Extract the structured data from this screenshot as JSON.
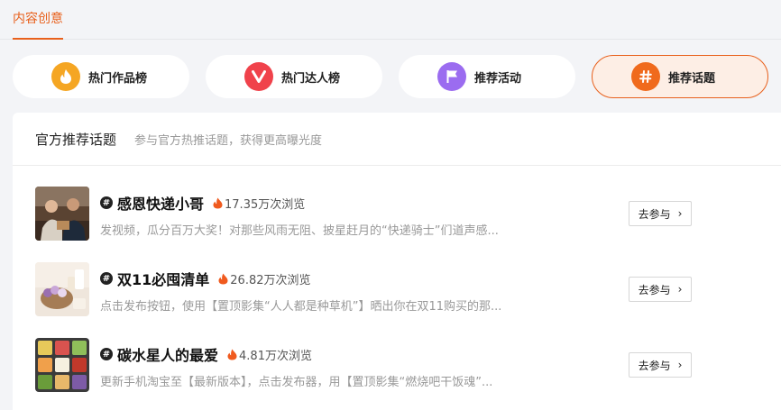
{
  "tabs": {
    "active_label": "内容创意"
  },
  "categories": [
    {
      "label": "热门作品榜",
      "icon": "flame-icon",
      "color": "#f5a623"
    },
    {
      "label": "热门达人榜",
      "icon": "v-badge-icon",
      "color": "#f0424b"
    },
    {
      "label": "推荐活动",
      "icon": "flag-icon",
      "color": "#9b6cf0"
    },
    {
      "label": "推荐话题",
      "icon": "hashtag-icon",
      "color": "#f06a1c",
      "active": true
    }
  ],
  "panel": {
    "title": "官方推荐话题",
    "subtitle": "参与官方热推话题，获得更高曝光度"
  },
  "topics": [
    {
      "title": "感恩快递小哥",
      "views": "17.35万次浏览",
      "desc": "发视频，瓜分百万大奖！对那些风雨无阻、披星赶月的“快递骑士”们道声感...",
      "action": "去参与"
    },
    {
      "title": "双11必囤清单",
      "views": "26.82万次浏览",
      "desc": "点击发布按钮，使用【置顶影集“人人都是种草机”】晒出你在双11购买的那...",
      "action": "去参与"
    },
    {
      "title": "碳水星人的最爱",
      "views": "4.81万次浏览",
      "desc": "更新手机淘宝至【最新版本】，点击发布器，用【置顶影集“燃烧吧干饭魂”...",
      "action": "去参与"
    }
  ],
  "colors": {
    "accent": "#e8601c",
    "fire": "#f05a1e"
  }
}
